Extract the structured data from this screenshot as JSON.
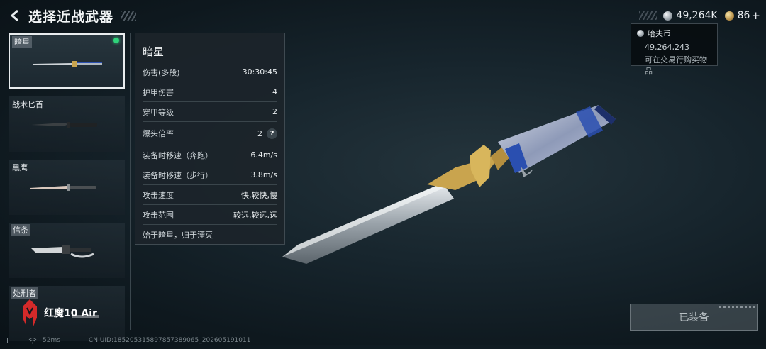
{
  "header": {
    "title": "选择近战武器",
    "back_icon": "back-arrow-icon"
  },
  "currency": {
    "havoc_coin": "49,264K",
    "gold": "86",
    "plus": "+",
    "tooltip": {
      "title": "哈夫币",
      "amount": "49,264,243",
      "desc": "可在交易行购买物品"
    }
  },
  "weapons": [
    {
      "name": "暗星",
      "selected": true,
      "equipped": true
    },
    {
      "name": "战术匕首",
      "selected": false
    },
    {
      "name": "黑鹰",
      "selected": false
    },
    {
      "name": "信条",
      "selected": false
    },
    {
      "name": "处刑者",
      "selected": false
    }
  ],
  "brand_overlay": {
    "text": "红魔10 Air"
  },
  "stats": {
    "title": "暗星",
    "rows": [
      {
        "label": "伤害(多段)",
        "value": "30:30:45"
      },
      {
        "label": "护甲伤害",
        "value": "4"
      },
      {
        "label": "穿甲等级",
        "value": "2"
      },
      {
        "label": "爆头倍率",
        "value": "2",
        "help": "?"
      },
      {
        "label": "装备时移速（奔跑）",
        "value": "6.4m/s"
      },
      {
        "label": "装备时移速（步行）",
        "value": "3.8m/s"
      },
      {
        "label": "攻击速度",
        "value": "快,较快,慢"
      },
      {
        "label": "攻击范围",
        "value": "较远,较远,远"
      }
    ],
    "description": "始于暗星，归于湮灭"
  },
  "equip_button": {
    "label": "已装备"
  },
  "status_bar": {
    "ping": "52ms",
    "uid": "CN UID:185205315897857389065_202605191011"
  },
  "colors": {
    "equipped_dot": "#2fd37a",
    "panel_bg": "#1c242a",
    "accent_gold": "#c9a44e",
    "accent_blue": "#2a4fb0"
  }
}
